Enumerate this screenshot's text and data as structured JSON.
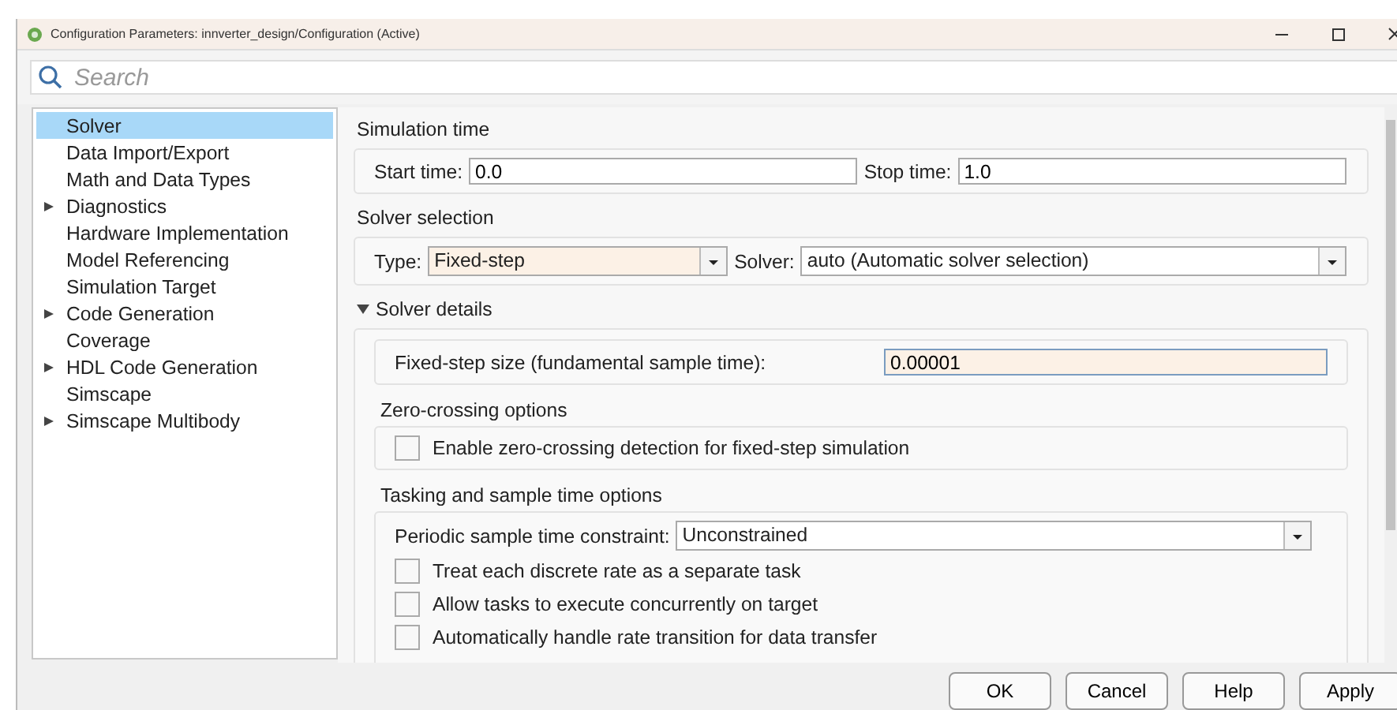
{
  "window": {
    "title": "Configuration Parameters: innverter_design/Configuration (Active)"
  },
  "search": {
    "placeholder": "Search"
  },
  "sidebar": {
    "items": [
      {
        "label": "Solver",
        "selected": true,
        "expandable": false
      },
      {
        "label": "Data Import/Export",
        "selected": false,
        "expandable": false
      },
      {
        "label": "Math and Data Types",
        "selected": false,
        "expandable": false
      },
      {
        "label": "Diagnostics",
        "selected": false,
        "expandable": true
      },
      {
        "label": "Hardware Implementation",
        "selected": false,
        "expandable": false
      },
      {
        "label": "Model Referencing",
        "selected": false,
        "expandable": false
      },
      {
        "label": "Simulation Target",
        "selected": false,
        "expandable": false
      },
      {
        "label": "Code Generation",
        "selected": false,
        "expandable": true
      },
      {
        "label": "Coverage",
        "selected": false,
        "expandable": false
      },
      {
        "label": "HDL Code Generation",
        "selected": false,
        "expandable": true
      },
      {
        "label": "Simscape",
        "selected": false,
        "expandable": false
      },
      {
        "label": "Simscape Multibody",
        "selected": false,
        "expandable": true
      }
    ]
  },
  "simulation_time": {
    "heading": "Simulation time",
    "start_label": "Start time:",
    "start_value": "0.0",
    "stop_label": "Stop time:",
    "stop_value": "1.0"
  },
  "solver_selection": {
    "heading": "Solver selection",
    "type_label": "Type:",
    "type_value": "Fixed-step",
    "solver_label": "Solver:",
    "solver_value": "auto (Automatic solver selection)"
  },
  "solver_details": {
    "heading": "Solver details",
    "expanded": true,
    "step_label": "Fixed-step size (fundamental sample time):",
    "step_value": "0.00001",
    "zero_crossing": {
      "heading": "Zero-crossing options",
      "options": [
        {
          "label": "Enable zero-crossing detection for fixed-step simulation",
          "checked": false
        }
      ]
    },
    "tasking": {
      "heading": "Tasking and sample time options",
      "constraint_label": "Periodic sample time constraint:",
      "constraint_value": "Unconstrained",
      "options": [
        {
          "label": "Treat each discrete rate as a separate task",
          "checked": false
        },
        {
          "label": "Allow tasks to execute concurrently on target",
          "checked": false
        },
        {
          "label": "Automatically handle rate transition for data transfer",
          "checked": false
        }
      ]
    }
  },
  "buttons": [
    "OK",
    "Cancel",
    "Help",
    "Apply"
  ]
}
